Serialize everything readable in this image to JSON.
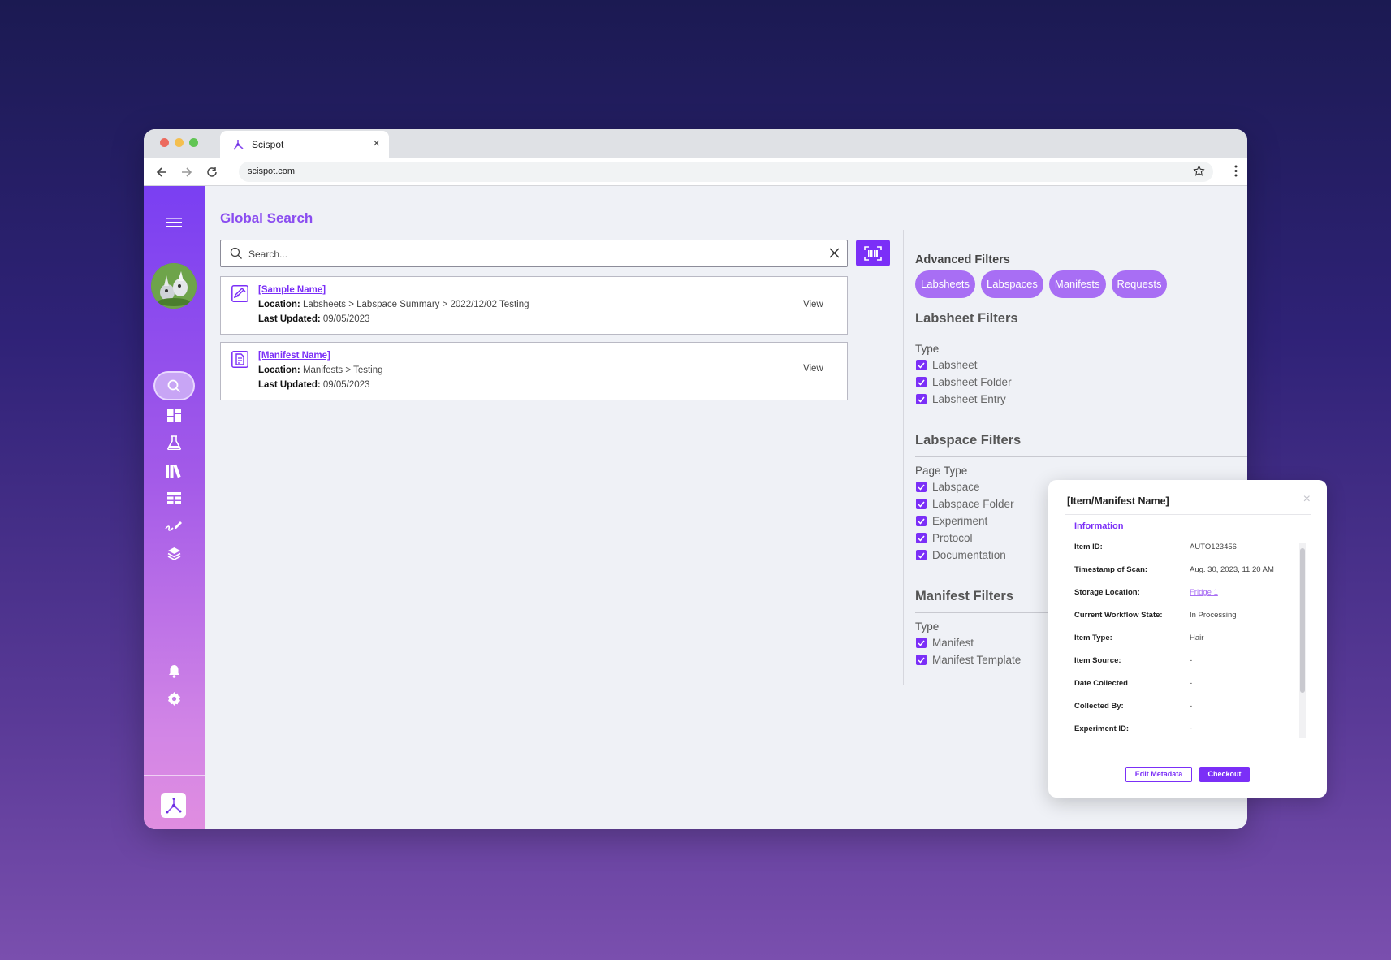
{
  "browser": {
    "tab_title": "Scispot",
    "url": "scispot.com",
    "colors": {
      "red": "#ec6a5e",
      "yellow": "#f4bf4f",
      "green": "#61c554"
    }
  },
  "sidebar": {
    "icons": [
      "menu-icon",
      "search-icon",
      "dashboard-icon",
      "flask-icon",
      "library-icon",
      "table-icon",
      "signature-icon",
      "layers-icon",
      "bell-icon",
      "gear-icon",
      "scispot-logo"
    ]
  },
  "main": {
    "title": "Global Search",
    "search_placeholder": "Search...",
    "results": [
      {
        "name": "[Sample Name]",
        "location_label": "Location:",
        "location": "Labsheets > Labspace Summary > 2022/12/02 Testing",
        "updated_label": "Last Updated:",
        "updated": "09/05/2023",
        "view": "View"
      },
      {
        "name": "[Manifest Name]",
        "location_label": "Location:",
        "location": "Manifests > Testing",
        "updated_label": "Last Updated:",
        "updated": "09/05/2023",
        "view": "View"
      }
    ]
  },
  "filters": {
    "title": "Advanced Filters",
    "chips": [
      "Labsheets",
      "Labspaces",
      "Manifests",
      "Requests"
    ],
    "labsheet": {
      "title": "Labsheet Filters",
      "sub": "Type",
      "options": [
        "Labsheet",
        "Labsheet Folder",
        "Labsheet Entry"
      ]
    },
    "labspace": {
      "title": "Labspace Filters",
      "sub": "Page Type",
      "options": [
        "Labspace",
        "Labspace Folder",
        "Experiment",
        "Protocol",
        "Documentation"
      ]
    },
    "manifest": {
      "title": "Manifest Filters",
      "sub": "Type",
      "options": [
        "Manifest",
        "Manifest Template"
      ]
    }
  },
  "modal": {
    "title": "[Item/Manifest Name]",
    "section": "Information",
    "rows": [
      {
        "label": "Item ID:",
        "value": "AUTO123456"
      },
      {
        "label": "Timestamp of Scan:",
        "value": "Aug. 30, 2023, 11:20 AM"
      },
      {
        "label": "Storage Location:",
        "value": "Fridge 1"
      },
      {
        "label": "Current Workflow State:",
        "value": "In Processing"
      },
      {
        "label": "Item Type:",
        "value": "Hair"
      },
      {
        "label": "Item Source:",
        "value": "-"
      },
      {
        "label": "Date Collected",
        "value": "-"
      },
      {
        "label": "Collected By:",
        "value": "-"
      },
      {
        "label": "Experiment ID:",
        "value": "-"
      }
    ],
    "edit_label": "Edit Metadata",
    "checkout_label": "Checkout"
  },
  "accent_color": "#7b2ff7"
}
